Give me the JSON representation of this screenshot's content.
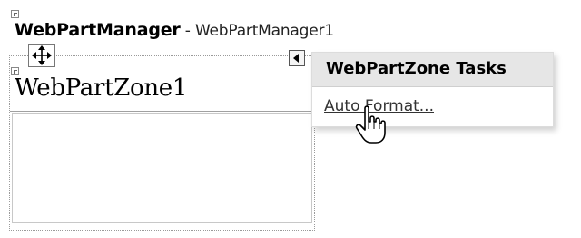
{
  "web_part_manager": {
    "control_type": "WebPartManager",
    "separator": " - ",
    "instance_id": "WebPartManager1"
  },
  "web_part_zone": {
    "title": "WebPartZone1"
  },
  "tasks_panel": {
    "title": "WebPartZone Tasks",
    "items": [
      {
        "label": "Auto Format..."
      }
    ]
  },
  "icons": {
    "control_glyph": "control-glyph-icon",
    "move_handle": "move-arrows-icon",
    "smart_tag": "smart-tag-arrow-icon",
    "cursor": "hand-pointer-icon"
  }
}
